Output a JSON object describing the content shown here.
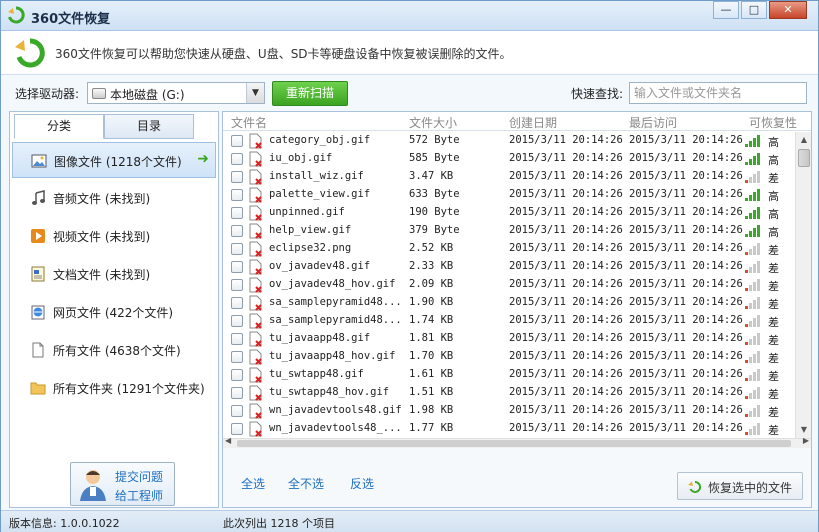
{
  "window": {
    "title": "360文件恢复",
    "min_label": "—",
    "max_label": "□",
    "close_label": "✕"
  },
  "info": {
    "text": "360文件恢复可以帮助您快速从硬盘、U盘、SD卡等硬盘设备中恢复被误删除的文件。"
  },
  "toolbar": {
    "drive_label": "选择驱动器:",
    "drive_value": "本地磁盘 (G:)",
    "rescan_label": "重新扫描",
    "search_label": "快速查找:",
    "search_placeholder": "输入文件或文件夹名"
  },
  "tabs": [
    {
      "label": "分类"
    },
    {
      "label": "目录"
    }
  ],
  "categories": [
    {
      "label": "图像文件 (1218个文件)",
      "icon": "image-icon"
    },
    {
      "label": "音频文件 (未找到)",
      "icon": "music-icon"
    },
    {
      "label": "视频文件 (未找到)",
      "icon": "video-icon"
    },
    {
      "label": "文档文件 (未找到)",
      "icon": "document-icon"
    },
    {
      "label": "网页文件 (422个文件)",
      "icon": "web-icon"
    },
    {
      "label": "所有文件 (4638个文件)",
      "icon": "file-icon"
    },
    {
      "label": "所有文件夹 (1291个文件夹)",
      "icon": "folder-icon"
    }
  ],
  "category_arrow": "➜",
  "helper": {
    "line1": "提交问题",
    "line2": "给工程师"
  },
  "table": {
    "headers": {
      "name": "文件名",
      "size": "文件大小",
      "created": "创建日期",
      "accessed": "最后访问",
      "recoverability": "可恢复性"
    },
    "rows": [
      {
        "name": "category_obj.gif",
        "size": "572 Byte",
        "created": "2015/3/11 20:14:26",
        "accessed": "2015/3/11 20:14:26",
        "rec": "高",
        "level": "high"
      },
      {
        "name": "iu_obj.gif",
        "size": "585 Byte",
        "created": "2015/3/11 20:14:26",
        "accessed": "2015/3/11 20:14:26",
        "rec": "高",
        "level": "high"
      },
      {
        "name": "install_wiz.gif",
        "size": "3.47 KB",
        "created": "2015/3/11 20:14:26",
        "accessed": "2015/3/11 20:14:26",
        "rec": "差",
        "level": "low"
      },
      {
        "name": "palette_view.gif",
        "size": "633 Byte",
        "created": "2015/3/11 20:14:26",
        "accessed": "2015/3/11 20:14:26",
        "rec": "高",
        "level": "high"
      },
      {
        "name": "unpinned.gif",
        "size": "190 Byte",
        "created": "2015/3/11 20:14:26",
        "accessed": "2015/3/11 20:14:26",
        "rec": "高",
        "level": "high"
      },
      {
        "name": "help_view.gif",
        "size": "379 Byte",
        "created": "2015/3/11 20:14:26",
        "accessed": "2015/3/11 20:14:26",
        "rec": "高",
        "level": "high"
      },
      {
        "name": "eclipse32.png",
        "size": "2.52 KB",
        "created": "2015/3/11 20:14:26",
        "accessed": "2015/3/11 20:14:26",
        "rec": "差",
        "level": "low"
      },
      {
        "name": "ov_javadev48.gif",
        "size": "2.33 KB",
        "created": "2015/3/11 20:14:26",
        "accessed": "2015/3/11 20:14:26",
        "rec": "差",
        "level": "low"
      },
      {
        "name": "ov_javadev48_hov.gif",
        "size": "2.09 KB",
        "created": "2015/3/11 20:14:26",
        "accessed": "2015/3/11 20:14:26",
        "rec": "差",
        "level": "low"
      },
      {
        "name": "sa_samplepyramid48...",
        "size": "1.90 KB",
        "created": "2015/3/11 20:14:26",
        "accessed": "2015/3/11 20:14:26",
        "rec": "差",
        "level": "low"
      },
      {
        "name": "sa_samplepyramid48...",
        "size": "1.74 KB",
        "created": "2015/3/11 20:14:26",
        "accessed": "2015/3/11 20:14:26",
        "rec": "差",
        "level": "low"
      },
      {
        "name": "tu_javaapp48.gif",
        "size": "1.81 KB",
        "created": "2015/3/11 20:14:26",
        "accessed": "2015/3/11 20:14:26",
        "rec": "差",
        "level": "low"
      },
      {
        "name": "tu_javaapp48_hov.gif",
        "size": "1.70 KB",
        "created": "2015/3/11 20:14:26",
        "accessed": "2015/3/11 20:14:26",
        "rec": "差",
        "level": "low"
      },
      {
        "name": "tu_swtapp48.gif",
        "size": "1.61 KB",
        "created": "2015/3/11 20:14:26",
        "accessed": "2015/3/11 20:14:26",
        "rec": "差",
        "level": "low"
      },
      {
        "name": "tu_swtapp48_hov.gif",
        "size": "1.51 KB",
        "created": "2015/3/11 20:14:26",
        "accessed": "2015/3/11 20:14:26",
        "rec": "差",
        "level": "low"
      },
      {
        "name": "wn_javadevtools48.gif",
        "size": "1.98 KB",
        "created": "2015/3/11 20:14:26",
        "accessed": "2015/3/11 20:14:26",
        "rec": "差",
        "level": "low"
      },
      {
        "name": "wn_javadevtools48_...",
        "size": "1.77 KB",
        "created": "2015/3/11 20:14:26",
        "accessed": "2015/3/11 20:14:26",
        "rec": "差",
        "level": "low"
      }
    ]
  },
  "actions": {
    "select_all": "全选",
    "select_none": "全不选",
    "invert": "反选",
    "recover_label": "恢复选中的文件"
  },
  "status": {
    "version": "版本信息: 1.0.0.1022",
    "count": "此次列出 1218 个项目"
  },
  "colors": {
    "signal_high": "#3aa829",
    "signal_low": "#e04a2a",
    "signal_empty": "#c9c9c9",
    "link": "#1f6fc1",
    "rescan": "#3ba322"
  }
}
